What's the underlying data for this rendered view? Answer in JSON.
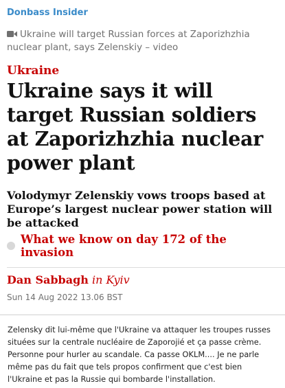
{
  "channel": {
    "name": "Donbass Insider"
  },
  "article": {
    "video_link": "Ukraine will target Russian forces at Zaporizhzhia nuclear plant, says Zelenskiy – video",
    "video_icon": "video-camera-icon",
    "kicker": "Ukraine",
    "headline": "Ukraine says it will target Russian soldiers at Zaporizhzhia nuclear power plant",
    "standfirst": "Volodymyr Zelenskiy vows troops based at Europe’s largest nuclear power station will be attacked",
    "related_link": "What we know on day 172 of the invasion",
    "byline_author": "Dan Sabbagh",
    "byline_location": "in Kyiv",
    "date": "Sun 14 Aug 2022 13.06 BST"
  },
  "comment": {
    "text": "Zelensky dit lui-même que l'Ukraine va attaquer les troupes russes situées sur la centrale nucléaire de Zaporojié et ça passe crème. Personne pour hurler au scandale. Ca passe OKLM.... Je ne parle même pas du fait que tels propos confirment que c'est bien l'Ukraine et pas la Russie qui bombarde l'installation."
  },
  "colors": {
    "accent_red": "#c70000",
    "channel_blue": "#3a8bc9",
    "meta_grey": "#707070"
  }
}
